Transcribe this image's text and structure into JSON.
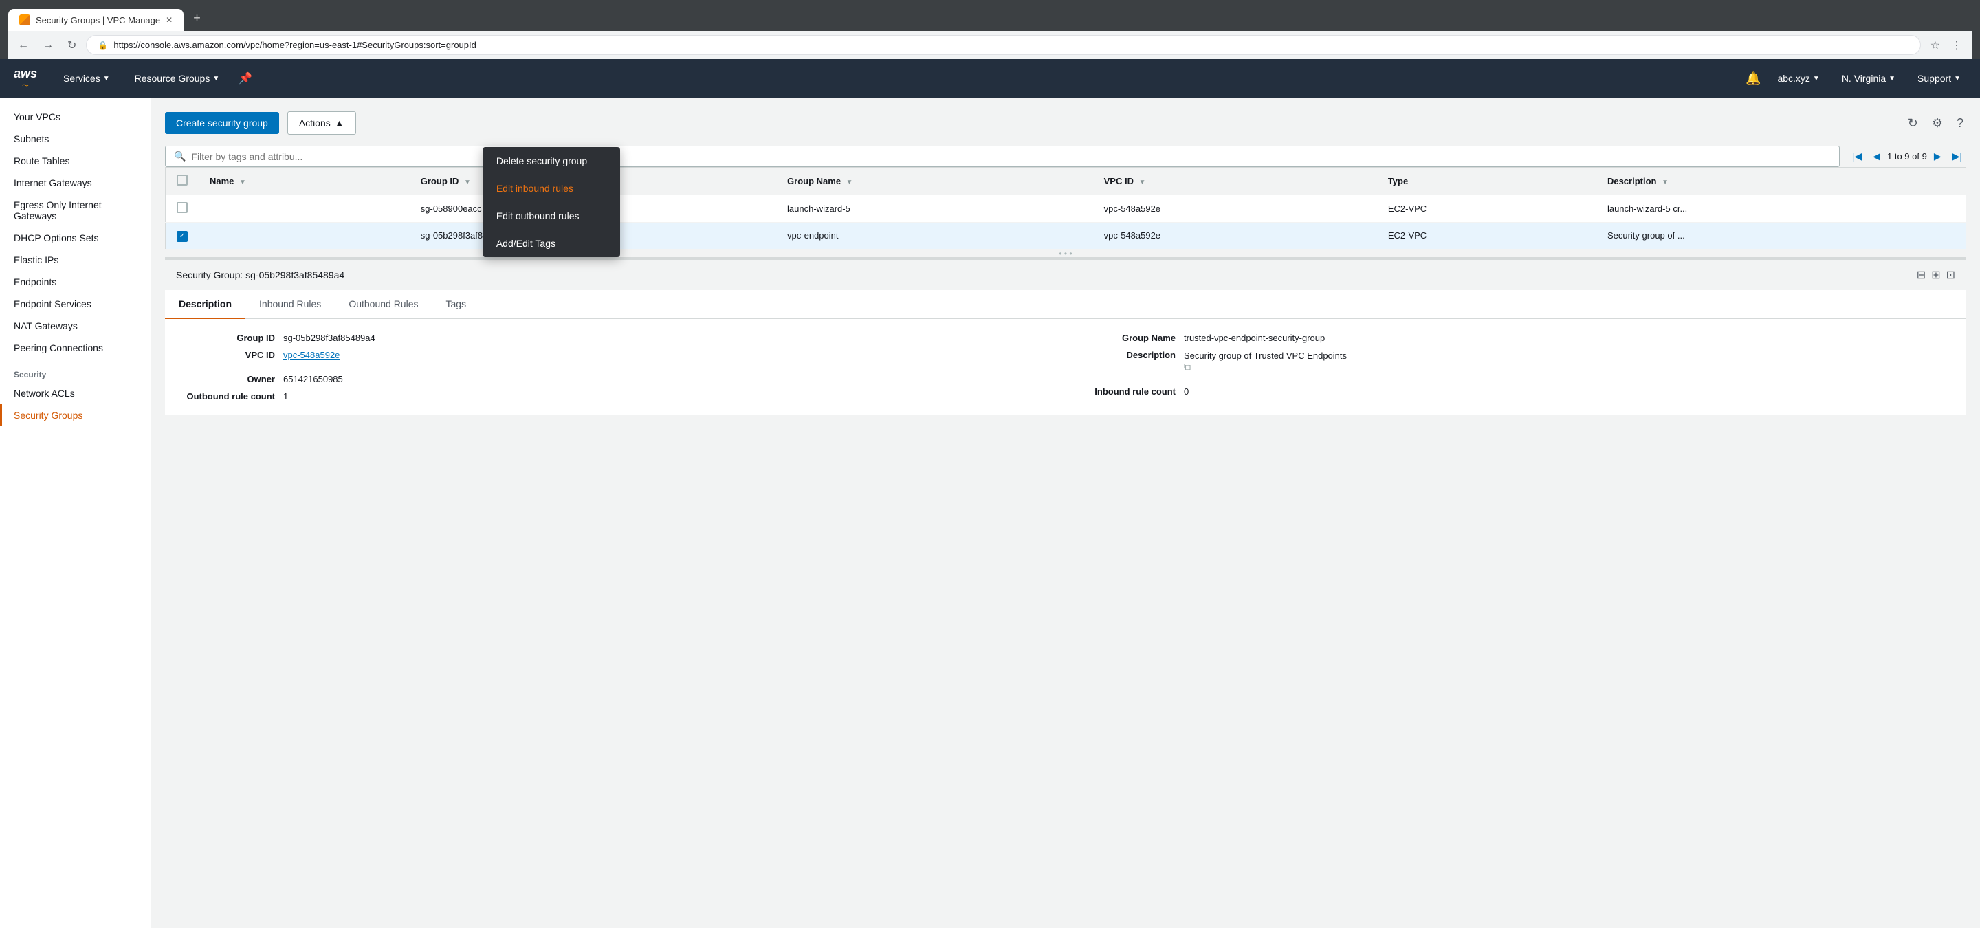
{
  "browser": {
    "tab_title": "Security Groups | VPC Manage",
    "url": "https://console.aws.amazon.com/vpc/home?region=us-east-1#SecurityGroups:sort=groupId",
    "new_tab_label": "+"
  },
  "topnav": {
    "logo": "aws",
    "services_label": "Services",
    "resource_groups_label": "Resource Groups",
    "bell_icon": "🔔",
    "user_label": "abc.xyz",
    "region_label": "N. Virginia",
    "support_label": "Support"
  },
  "sidebar": {
    "items": [
      {
        "label": "Your VPCs",
        "active": false
      },
      {
        "label": "Subnets",
        "active": false
      },
      {
        "label": "Route Tables",
        "active": false
      },
      {
        "label": "Internet Gateways",
        "active": false
      },
      {
        "label": "Egress Only Internet Gateways",
        "active": false
      },
      {
        "label": "DHCP Options Sets",
        "active": false
      },
      {
        "label": "Elastic IPs",
        "active": false
      },
      {
        "label": "Endpoints",
        "active": false
      },
      {
        "label": "Endpoint Services",
        "active": false
      },
      {
        "label": "NAT Gateways",
        "active": false
      },
      {
        "label": "Peering Connections",
        "active": false
      }
    ],
    "security_section_header": "Security",
    "security_items": [
      {
        "label": "Network ACLs",
        "active": false
      },
      {
        "label": "Security Groups",
        "active": true
      }
    ]
  },
  "toolbar": {
    "create_label": "Create security group",
    "actions_label": "Actions",
    "actions_open": true,
    "refresh_icon": "↻",
    "settings_icon": "⚙",
    "help_icon": "?"
  },
  "actions_menu": {
    "items": [
      {
        "label": "Delete security group",
        "style": "normal"
      },
      {
        "label": "Edit inbound rules",
        "style": "orange"
      },
      {
        "label": "Edit outbound rules",
        "style": "normal"
      },
      {
        "label": "Add/Edit Tags",
        "style": "normal"
      }
    ]
  },
  "search": {
    "placeholder": "Filter by tags and attribu..."
  },
  "pagination": {
    "text": "1 to 9 of 9"
  },
  "table": {
    "columns": [
      {
        "label": "Name",
        "sortable": true
      },
      {
        "label": "Group ID",
        "sortable": true
      },
      {
        "label": "Group Name",
        "sortable": true
      },
      {
        "label": "VPC ID",
        "sortable": true
      },
      {
        "label": "Type",
        "sortable": false
      },
      {
        "label": "Description",
        "sortable": true
      }
    ],
    "rows": [
      {
        "checked": false,
        "selected": false,
        "name": "",
        "group_id": "sg-058900eacc7c...",
        "group_name": "launch-wizard-5",
        "vpc_id": "vpc-548a592e",
        "type": "EC2-VPC",
        "description": "launch-wizard-5 cr..."
      },
      {
        "checked": true,
        "selected": true,
        "name": "",
        "group_id": "sg-05b298f3af854...",
        "group_name": "vpc-endpoint",
        "vpc_id": "vpc-548a592e",
        "type": "EC2-VPC",
        "description": "Security group of ..."
      }
    ]
  },
  "detail_panel": {
    "title": "Security Group: sg-05b298f3af85489a4",
    "tabs": [
      {
        "label": "Description",
        "active": true
      },
      {
        "label": "Inbound Rules",
        "active": false
      },
      {
        "label": "Outbound Rules",
        "active": false
      },
      {
        "label": "Tags",
        "active": false
      }
    ],
    "fields_left": [
      {
        "label": "Group ID",
        "value": "sg-05b298f3af85489a4"
      },
      {
        "label": "VPC ID",
        "value": "vpc-548a592e"
      },
      {
        "label": "",
        "value": ""
      },
      {
        "label": "Owner",
        "value": "651421650985"
      },
      {
        "label": "Outbound rule count",
        "value": "1"
      }
    ],
    "fields_right": [
      {
        "label": "Group Name",
        "value": "trusted-vpc-endpoint-security-group"
      },
      {
        "label": "Description",
        "value": "Security group of Trusted VPC Endpoints"
      },
      {
        "label": "Inbound rule count",
        "value": "0"
      }
    ]
  }
}
